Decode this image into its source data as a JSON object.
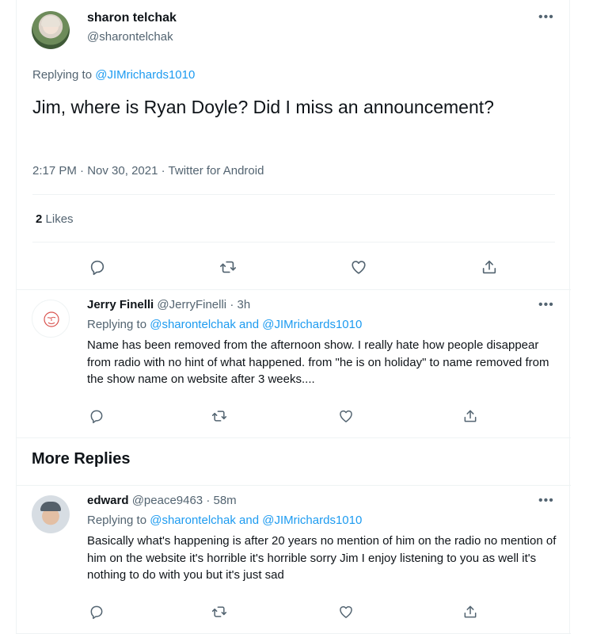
{
  "main_tweet": {
    "author_name": "sharon telchak",
    "author_handle": "@sharontelchak",
    "replying_prefix": "Replying to",
    "replying_to": "@JIMrichards1010",
    "text": "Jim, where is Ryan Doyle?  Did I miss an announcement?",
    "time": "2:17 PM",
    "date": "Nov 30, 2021",
    "source": "Twitter for Android",
    "likes_count": "2",
    "likes_label": "Likes"
  },
  "replies": [
    {
      "author_name": "Jerry Finelli",
      "author_handle": "@JerryFinelli",
      "age": "3h",
      "replying_prefix": "Replying to",
      "replying_to_1": "@sharontelchak",
      "replying_and": "and",
      "replying_to_2": "@JIMrichards1010",
      "text": "Name has been removed from the afternoon show. I really hate how people disappear from radio with no hint of what happened. from \"he is on holiday\" to name removed from the show name on website after 3 weeks...."
    },
    {
      "author_name": "edward",
      "author_handle": "@peace9463",
      "age": "58m",
      "replying_prefix": "Replying to",
      "replying_to_1": "@sharontelchak",
      "replying_and": "and",
      "replying_to_2": "@JIMrichards1010",
      "text": "Basically what's happening is after 20 years no  mention of him on the radio no mention of him on the website it's horrible it's horrible sorry Jim I enjoy listening to you as well it's nothing to do with you but it's just sad"
    }
  ],
  "more_replies_title": "More Replies",
  "separator_dot": "·",
  "more_glyph": "•••",
  "icons": [
    "reply-icon",
    "retweet-icon",
    "like-icon",
    "share-icon",
    "more-icon"
  ],
  "colors": {
    "link": "#1d9bf0",
    "secondary_text": "#536471",
    "primary_text": "#0f1419",
    "border": "#eff3f4"
  }
}
